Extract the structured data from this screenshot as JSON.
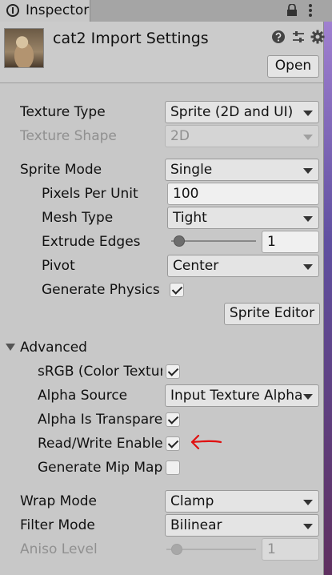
{
  "window": {
    "tab_label": "Inspector"
  },
  "header": {
    "title": "cat2 Import Settings",
    "open_button": "Open"
  },
  "fields": {
    "texture_type": {
      "label": "Texture Type",
      "value": "Sprite (2D and UI)"
    },
    "texture_shape": {
      "label": "Texture Shape",
      "value": "2D"
    },
    "sprite_mode": {
      "label": "Sprite Mode",
      "value": "Single"
    },
    "pixels_per_unit": {
      "label": "Pixels Per Unit",
      "value": "100"
    },
    "mesh_type": {
      "label": "Mesh Type",
      "value": "Tight"
    },
    "extrude_edges": {
      "label": "Extrude Edges",
      "value": "1",
      "slider_fraction": 0.03
    },
    "pivot": {
      "label": "Pivot",
      "value": "Center"
    },
    "generate_physics": {
      "label": "Generate Physics",
      "checked": true
    },
    "sprite_editor_button": "Sprite Editor",
    "advanced": {
      "label": "Advanced",
      "expanded": true
    },
    "srgb": {
      "label": "sRGB (Color Texture)",
      "checked": true
    },
    "alpha_source": {
      "label": "Alpha Source",
      "value": "Input Texture Alpha"
    },
    "alpha_is_transparency": {
      "label": "Alpha Is Transparency",
      "checked": true
    },
    "read_write_enabled": {
      "label": "Read/Write Enabled",
      "checked": true
    },
    "generate_mip_maps": {
      "label": "Generate Mip Maps",
      "checked": false
    },
    "wrap_mode": {
      "label": "Wrap Mode",
      "value": "Clamp"
    },
    "filter_mode": {
      "label": "Filter Mode",
      "value": "Bilinear"
    },
    "aniso_level": {
      "label": "Aniso Level",
      "value": "1",
      "slider_fraction": 0.0
    }
  },
  "annotation": {
    "color": "#e01010"
  }
}
